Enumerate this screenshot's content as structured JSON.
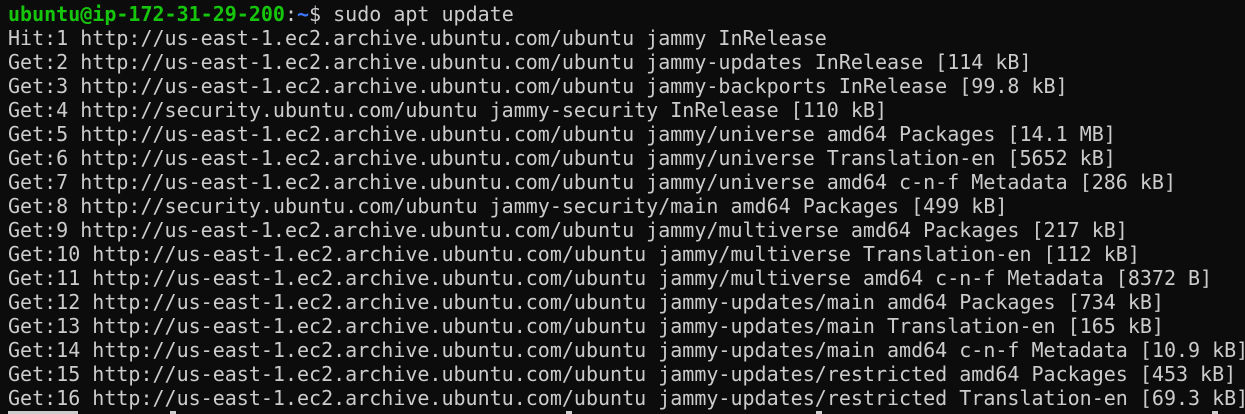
{
  "prompt": {
    "user_host": "ubuntu@ip-172-31-29-200",
    "separator": ":",
    "path": "~",
    "dollar": "$",
    "command": " sudo apt update"
  },
  "output_lines": [
    "Hit:1 http://us-east-1.ec2.archive.ubuntu.com/ubuntu jammy InRelease",
    "Get:2 http://us-east-1.ec2.archive.ubuntu.com/ubuntu jammy-updates InRelease [114 kB]",
    "Get:3 http://us-east-1.ec2.archive.ubuntu.com/ubuntu jammy-backports InRelease [99.8 kB]",
    "Get:4 http://security.ubuntu.com/ubuntu jammy-security InRelease [110 kB]",
    "Get:5 http://us-east-1.ec2.archive.ubuntu.com/ubuntu jammy/universe amd64 Packages [14.1 MB]",
    "Get:6 http://us-east-1.ec2.archive.ubuntu.com/ubuntu jammy/universe Translation-en [5652 kB]",
    "Get:7 http://us-east-1.ec2.archive.ubuntu.com/ubuntu jammy/universe amd64 c-n-f Metadata [286 kB]",
    "Get:8 http://security.ubuntu.com/ubuntu jammy-security/main amd64 Packages [499 kB]",
    "Get:9 http://us-east-1.ec2.archive.ubuntu.com/ubuntu jammy/multiverse amd64 Packages [217 kB]",
    "Get:10 http://us-east-1.ec2.archive.ubuntu.com/ubuntu jammy/multiverse Translation-en [112 kB]",
    "Get:11 http://us-east-1.ec2.archive.ubuntu.com/ubuntu jammy/multiverse amd64 c-n-f Metadata [8372 B]",
    "Get:12 http://us-east-1.ec2.archive.ubuntu.com/ubuntu jammy-updates/main amd64 Packages [734 kB]",
    "Get:13 http://us-east-1.ec2.archive.ubuntu.com/ubuntu jammy-updates/main Translation-en [165 kB]",
    "Get:14 http://us-east-1.ec2.archive.ubuntu.com/ubuntu jammy-updates/main amd64 c-n-f Metadata [10.9 kB]",
    "Get:15 http://us-east-1.ec2.archive.ubuntu.com/ubuntu jammy-updates/restricted amd64 Packages [453 kB]",
    "Get:16 http://us-east-1.ec2.archive.ubuntu.com/ubuntu jammy-updates/restricted Translation-en [69.3 kB]"
  ],
  "colors": {
    "background": "#0c0c0c",
    "text": "#cccccc",
    "prompt_user": "#16c60c",
    "prompt_path": "#3b78ff"
  }
}
